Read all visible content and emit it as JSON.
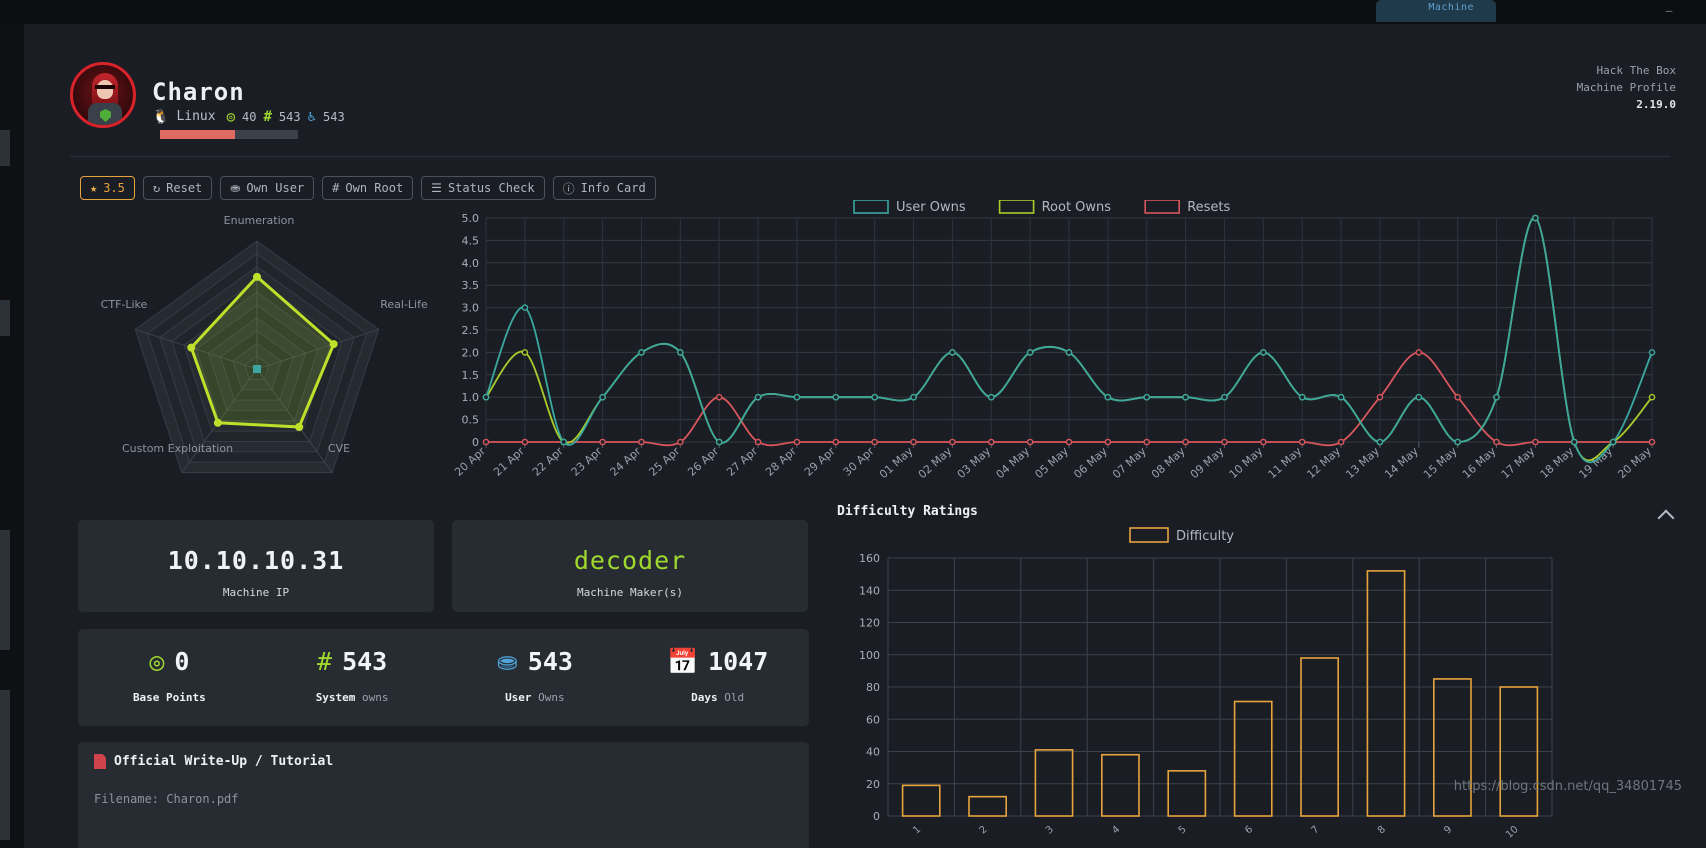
{
  "window": {
    "tab_label": "Machine",
    "minimize_label": "—"
  },
  "header": {
    "machine_name": "Charon",
    "os_icon": "penguin-icon",
    "os": "Linux",
    "points_icon": "target-icon",
    "points": "40",
    "system_owns_icon": "hash-icon",
    "system_owns": "543",
    "user_owns_icon": "user-icon",
    "user_owns": "543",
    "rating_percent": 54,
    "brand_line1": "Hack The Box",
    "brand_line2": "Machine Profile",
    "version": "2.19.0"
  },
  "toolbar": {
    "buttons": [
      {
        "label": "3.5",
        "icon": "star-icon",
        "highlight": true
      },
      {
        "label": "Reset",
        "icon": "refresh-icon",
        "highlight": false
      },
      {
        "label": "Own User",
        "icon": "user-icon",
        "highlight": false
      },
      {
        "label": "Own Root",
        "icon": "hash-icon",
        "highlight": false
      },
      {
        "label": "Status Check",
        "icon": "list-icon",
        "highlight": false
      },
      {
        "label": "Info Card",
        "icon": "info-icon",
        "highlight": false
      }
    ]
  },
  "cards": {
    "machine_ip": {
      "value": "10.10.10.31",
      "caption": "Machine IP"
    },
    "machine_maker": {
      "value": "decoder",
      "caption": "Machine Maker(s)"
    }
  },
  "stats": [
    {
      "icon": "target-icon",
      "icon_color": "green",
      "value": "0",
      "caption_strong": "Base Points",
      "caption_dim": ""
    },
    {
      "icon": "hash-icon",
      "icon_color": "green",
      "value": "543",
      "caption_strong": "System",
      "caption_dim": "owns"
    },
    {
      "icon": "user-icon",
      "icon_color": "blue",
      "value": "543",
      "caption_strong": "User",
      "caption_dim": "Owns"
    },
    {
      "icon": "calendar-icon",
      "icon_color": "white",
      "value": "1047",
      "caption_strong": "Days",
      "caption_dim": "Old"
    }
  ],
  "writeup": {
    "title": "Official Write-Up / Tutorial",
    "filename": "Filename: Charon.pdf"
  },
  "difficulty_panel": {
    "title": "Difficulty Ratings",
    "collapse_icon": "chevron-up-icon"
  },
  "watermark": "https://blog.csdn.net/qq_34801745",
  "colors": {
    "accent_green": "#9fd92e",
    "accent_orange": "#e8a33d",
    "accent_blue": "#4fa3d8",
    "accent_red": "#d0434a",
    "user_owns": "#3aa8a0",
    "root_owns": "#a8cc2b",
    "resets": "#d9565c",
    "panel": "#272c33",
    "background": "#1a1e24"
  },
  "chart_data": [
    {
      "type": "radar",
      "title": "",
      "categories": [
        "Enumeration",
        "Real-Life",
        "CVE",
        "Custom Exploitation",
        "CTF-Like"
      ],
      "values": [
        7.2,
        6.3,
        5.6,
        5.2,
        5.4
      ],
      "rmax": 10,
      "rings": 10,
      "series_color": "#bfe02b",
      "center_point_color": "#3aa8a0"
    },
    {
      "type": "line",
      "title": "",
      "xlabel": "",
      "ylabel": "",
      "ylim": [
        0,
        5
      ],
      "yticks": [
        0,
        0.5,
        1.0,
        1.5,
        2.0,
        2.5,
        3.0,
        3.5,
        4.0,
        4.5,
        5.0
      ],
      "ytick_labels": [
        "0",
        "0.5",
        "1.0",
        "1.5",
        "2.0",
        "2.5",
        "3.0",
        "3.5",
        "4.0",
        "4.5",
        "5.0"
      ],
      "grid": true,
      "legend_position": "top",
      "x": [
        "20 Apr",
        "21 Apr",
        "22 Apr",
        "23 Apr",
        "24 Apr",
        "25 Apr",
        "26 Apr",
        "27 Apr",
        "28 Apr",
        "29 Apr",
        "30 Apr",
        "01 May",
        "02 May",
        "03 May",
        "04 May",
        "05 May",
        "06 May",
        "07 May",
        "08 May",
        "09 May",
        "10 May",
        "11 May",
        "12 May",
        "13 May",
        "14 May",
        "15 May",
        "16 May",
        "17 May",
        "18 May",
        "19 May",
        "20 May"
      ],
      "series": [
        {
          "name": "User Owns",
          "color": "#3aa8a0",
          "values": [
            1,
            3,
            0,
            1,
            2,
            2,
            0,
            1,
            1,
            1,
            1,
            1,
            2,
            1,
            2,
            2,
            1,
            1,
            1,
            1,
            2,
            1,
            1,
            0,
            1,
            0,
            1,
            5,
            0,
            0,
            2
          ]
        },
        {
          "name": "Root Owns",
          "color": "#a8cc2b",
          "values": [
            1,
            2,
            0,
            1,
            2,
            2,
            0,
            1,
            1,
            1,
            1,
            1,
            2,
            1,
            2,
            2,
            1,
            1,
            1,
            1,
            2,
            1,
            1,
            0,
            1,
            0,
            1,
            5,
            0,
            0,
            1
          ]
        },
        {
          "name": "Resets",
          "color": "#d9565c",
          "values": [
            0,
            0,
            0,
            0,
            0,
            0,
            1,
            0,
            0,
            0,
            0,
            0,
            0,
            0,
            0,
            0,
            0,
            0,
            0,
            0,
            0,
            0,
            0,
            1,
            2,
            1,
            0,
            0,
            0,
            0,
            0
          ]
        }
      ]
    },
    {
      "type": "bar",
      "title": "Difficulty Ratings",
      "xlabel": "",
      "ylabel": "",
      "ylim": [
        0,
        160
      ],
      "yticks": [
        0,
        20,
        40,
        60,
        80,
        100,
        120,
        140,
        160
      ],
      "grid": true,
      "legend": [
        "Difficulty"
      ],
      "legend_position": "top",
      "bar_color": "#e8a33d",
      "categories": [
        "1",
        "2",
        "3",
        "4",
        "5",
        "6",
        "7",
        "8",
        "9",
        "10"
      ],
      "values": [
        19,
        12,
        41,
        38,
        28,
        71,
        98,
        152,
        85,
        80
      ]
    }
  ]
}
